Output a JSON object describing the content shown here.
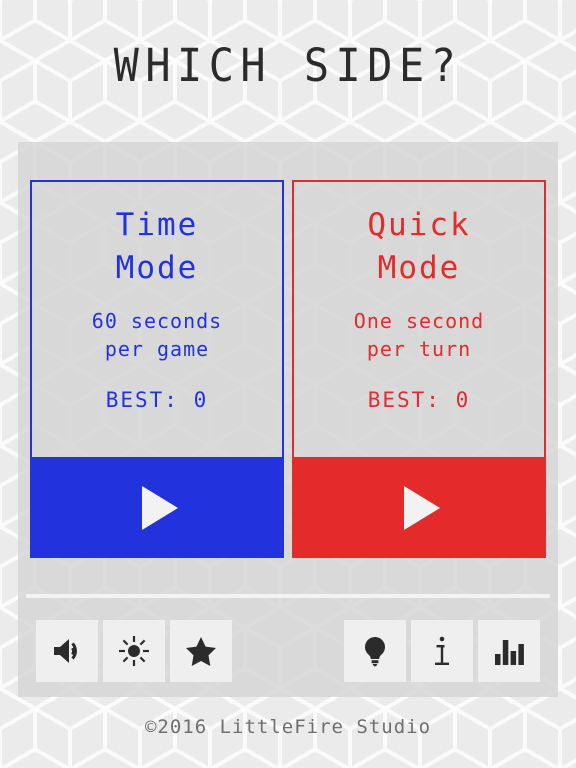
{
  "app": {
    "title": "WHICH SIDE?",
    "footer": "©2016 LittleFire Studio",
    "background_color": "#ebebeb",
    "panel_color": "#d4d4d4"
  },
  "modes": [
    {
      "id": "time-mode",
      "title": "Time\nMode",
      "description": "60 seconds\nper game",
      "best_label": "BEST: 0",
      "best_value": "0",
      "color": "#2233dd",
      "play_label": "play"
    },
    {
      "id": "quick-mode",
      "title": "Quick\nMode",
      "description": "One second\nper turn",
      "best_label": "BEST: 0",
      "best_value": "0",
      "color": "#e32b2b",
      "play_label": "play"
    }
  ],
  "toolbar": {
    "left": [
      {
        "id": "sound",
        "icon": "speaker-icon",
        "label": "Sound"
      },
      {
        "id": "brightness",
        "icon": "sun-icon",
        "label": "Brightness"
      },
      {
        "id": "rate",
        "icon": "star-icon",
        "label": "Rate"
      }
    ],
    "right": [
      {
        "id": "hint",
        "icon": "lightbulb-icon",
        "label": "Hint"
      },
      {
        "id": "info",
        "icon": "info-icon",
        "label": "Info"
      },
      {
        "id": "stats",
        "icon": "bar-chart-icon",
        "label": "Stats"
      }
    ]
  }
}
